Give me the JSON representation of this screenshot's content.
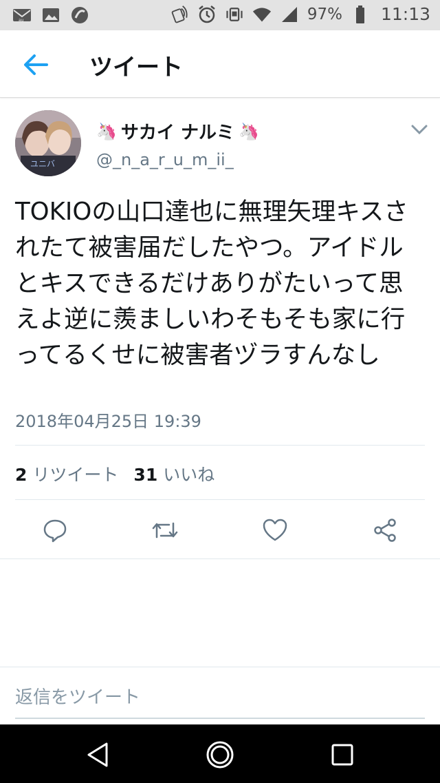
{
  "status_bar": {
    "left_icons": [
      "mail-au-icon",
      "gallery-icon",
      "app-icon"
    ],
    "right_icons": [
      "nfc-icon",
      "alarm-icon",
      "vibrate-icon",
      "wifi-icon",
      "signal-icon"
    ],
    "battery": "97%",
    "time": "11:13"
  },
  "header": {
    "title": "ツイート",
    "back_icon": "arrow-left-icon"
  },
  "tweet": {
    "name": "サカイ ナルミ",
    "name_emoji_left": "🦄",
    "name_emoji_right": "🦄",
    "handle": "@_n_a_r_u_m_ii_",
    "text": "TOKIOの山口達也に無理矢理キスされたて被害届だしたやつ。アイドルとキスできるだけありがたいって思えよ逆に羨ましいわそもそも家に行ってるくせに被害者ヅラすんなし",
    "timestamp": "2018年04月25日 19:39",
    "retweets": "2",
    "retweets_label": "リツイート",
    "likes": "31",
    "likes_label": "いいね"
  },
  "actions": [
    "reply-icon",
    "retweet-icon",
    "like-icon",
    "share-icon"
  ],
  "reply": {
    "placeholder": "返信をツイート"
  },
  "colors": {
    "accent": "#1da1f2",
    "secondary_text": "#657786",
    "icon_gray": "#657786",
    "status_bar_bg": "#e3e3e3"
  },
  "nav_bar": [
    "back-triangle-icon",
    "home-circle-icon",
    "recents-square-icon"
  ]
}
